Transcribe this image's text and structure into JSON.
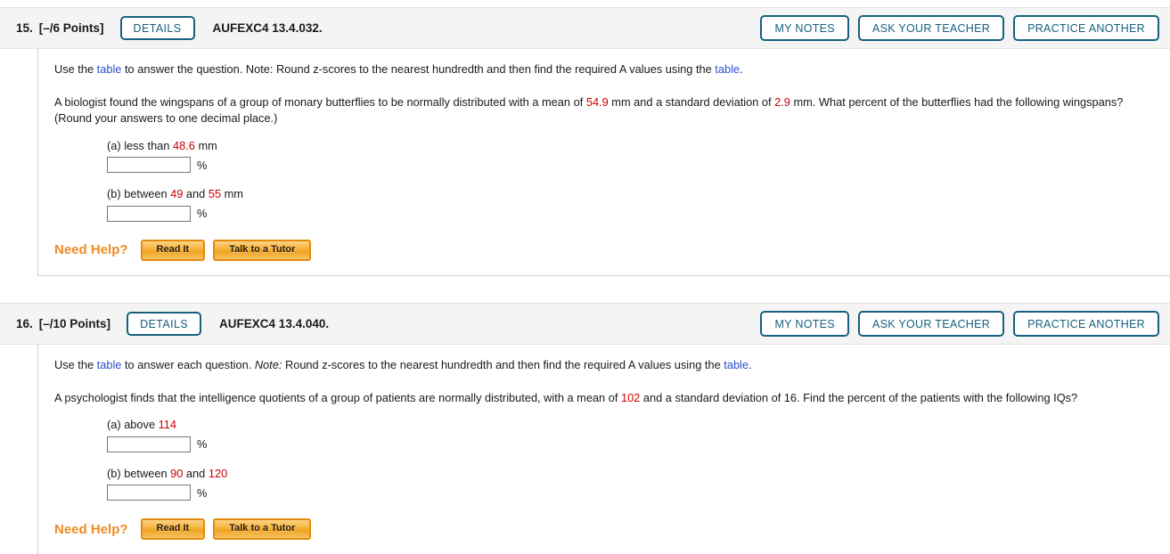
{
  "questions": [
    {
      "number": "15.",
      "points": "[–/6 Points]",
      "details_label": "DETAILS",
      "code": "AUFEXC4 13.4.032.",
      "actions": [
        {
          "label": "MY NOTES"
        },
        {
          "label": "ASK YOUR TEACHER"
        },
        {
          "label": "PRACTICE ANOTHER"
        }
      ],
      "instruction": {
        "pre": "Use the ",
        "link1": "table",
        "mid": " to answer the question. Note: Round z-scores to the nearest hundredth and then find the required A values using the ",
        "link2": "table",
        "post": "."
      },
      "prompt": {
        "seg1": "A biologist found the wingspans of a group of monary butterflies to be normally distributed with a mean of ",
        "val1": "54.9",
        "seg2": " mm and a standard deviation of ",
        "val2": "2.9",
        "seg3": " mm. What percent of the butterflies had the following wingspans? (Round your answers to one decimal place.)"
      },
      "parts": [
        {
          "prefix": "(a) less than ",
          "value": "48.6",
          "suffix": " mm",
          "input_value": "",
          "unit": "%"
        },
        {
          "prefix": "(b) between ",
          "value": "49",
          "middle": " and ",
          "value2": "55",
          "suffix": " mm",
          "input_value": "",
          "unit": "%"
        }
      ],
      "need_help": {
        "label": "Need Help?",
        "read_it": "Read It",
        "tutor": "Talk to a Tutor"
      }
    },
    {
      "number": "16.",
      "points": "[–/10 Points]",
      "details_label": "DETAILS",
      "code": "AUFEXC4 13.4.040.",
      "actions": [
        {
          "label": "MY NOTES"
        },
        {
          "label": "ASK YOUR TEACHER"
        },
        {
          "label": "PRACTICE ANOTHER"
        }
      ],
      "instruction": {
        "pre": "Use the ",
        "link1": "table",
        "mid_a": " to answer each question. ",
        "note": "Note:",
        "mid_b": " Round z-scores to the nearest hundredth and then find the required A values using the ",
        "link2": "table",
        "post": "."
      },
      "prompt": {
        "seg1": "A psychologist finds that the intelligence quotients of a group of patients are normally distributed, with a mean of ",
        "val1": "102",
        "seg2": " and a standard deviation of 16. Find the percent of the patients with the following IQs?"
      },
      "parts": [
        {
          "prefix": "(a) above ",
          "value": "114",
          "suffix": "",
          "input_value": "",
          "unit": "%"
        },
        {
          "prefix": "(b) between ",
          "value": "90",
          "middle": " and ",
          "value2": "120",
          "suffix": "",
          "input_value": "",
          "unit": "%"
        }
      ],
      "need_help": {
        "label": "Need Help?",
        "read_it": "Read It",
        "tutor": "Talk to a Tutor"
      }
    }
  ],
  "colors": {
    "accent_blue": "#17607f",
    "link_blue": "#2b4fd1",
    "value_red": "#cc0000",
    "help_orange": "#ef8b22",
    "header_bg": "#f4f4f4"
  }
}
